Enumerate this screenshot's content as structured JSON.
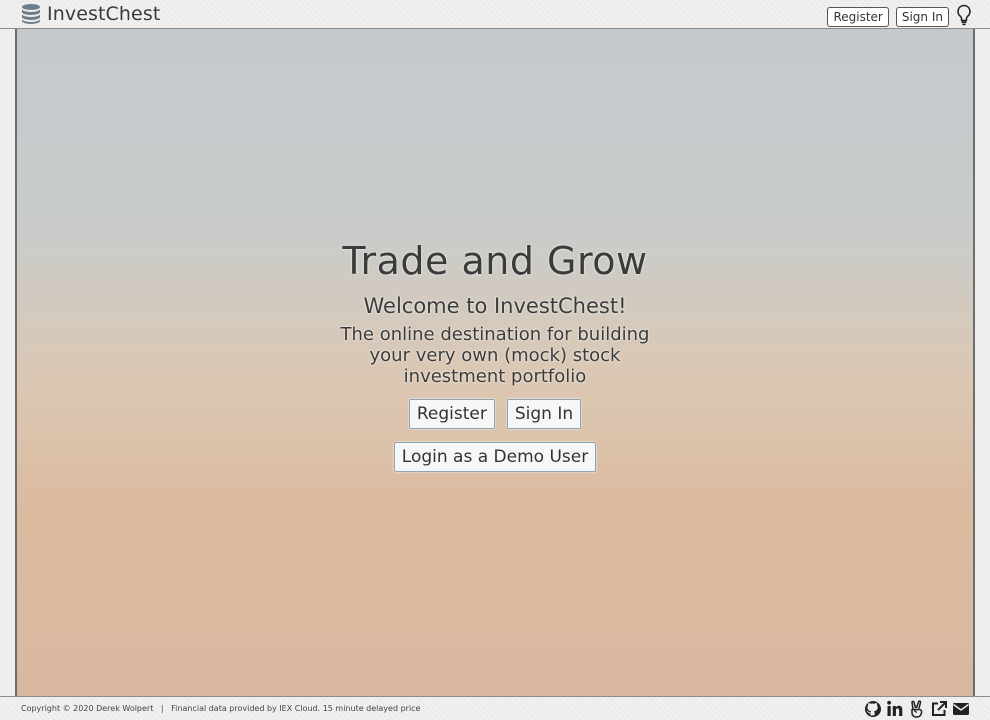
{
  "header": {
    "brand": "InvestChest",
    "logo_icon": "database-coins-icon",
    "register_label": "Register",
    "signin_label": "Sign In",
    "theme_icon": "lightbulb-icon"
  },
  "hero": {
    "title": "Trade and Grow",
    "subtitle": "Welcome to InvestChest!",
    "description": "The online destination for building your very own (mock) stock investment portfolio",
    "register_label": "Register",
    "signin_label": "Sign In",
    "demo_label": "Login as a Demo User"
  },
  "footer": {
    "copyright": "Copyright © 2020 Derek Wolpert",
    "separator": "|",
    "data_note": "Financial data provided by IEX Cloud. 15 minute delayed price",
    "icons": [
      "github-icon",
      "linkedin-icon",
      "angellist-icon",
      "external-link-icon",
      "envelope-icon"
    ]
  },
  "colors": {
    "text": "#3b3b3b",
    "hero_top": "#c4c9cd",
    "hero_bottom": "#d9b8a2"
  }
}
